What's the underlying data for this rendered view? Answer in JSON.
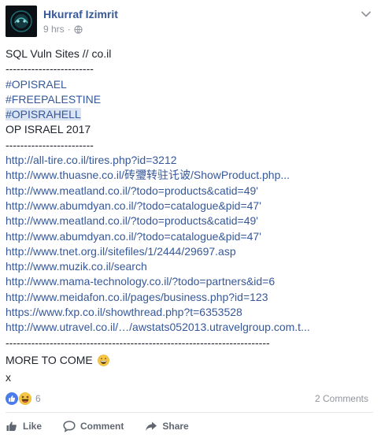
{
  "post": {
    "author": "Hkurraf Izimrit",
    "timestamp": "9 hrs",
    "separator": "·",
    "privacy_icon": "globe-icon",
    "options_icon": "chevron-down-icon"
  },
  "content": {
    "lines": [
      {
        "text": "SQL Vuln Sites // co.il",
        "kind": "text"
      },
      {
        "text": "------------------------",
        "kind": "text"
      },
      {
        "text": "#OPISRAEL",
        "kind": "hashtag"
      },
      {
        "text": "#FREEPALESTINE",
        "kind": "hashtag"
      },
      {
        "text": "#OPISRAHELL",
        "kind": "hashtag-highlight"
      },
      {
        "text": "OP ISRAEL 2017",
        "kind": "text"
      },
      {
        "text": "------------------------",
        "kind": "text"
      },
      {
        "text": "http://all-tire.co.il/tires.php?id=3212",
        "kind": "link"
      },
      {
        "text": "http://www.thuasne.co.il/砖瓕转驻讬诐/ShowProduct.php...",
        "kind": "link"
      },
      {
        "text": "http://www.meatland.co.il/?todo=products&catid=49'",
        "kind": "link"
      },
      {
        "text": "http://www.abumdyan.co.il/?todo=catalogue&pid=47'",
        "kind": "link"
      },
      {
        "text": "http://www.meatland.co.il/?todo=products&catid=49'",
        "kind": "link"
      },
      {
        "text": "http://www.abumdyan.co.il/?todo=catalogue&pid=47'",
        "kind": "link"
      },
      {
        "text": "http://www.tnet.org.il/sitefiles/1/2444/29697.asp",
        "kind": "link"
      },
      {
        "text": "http://www.muzik.co.il/search",
        "kind": "link"
      },
      {
        "text": "http://www.mama-technology.co.il/?todo=partners&id=6",
        "kind": "link"
      },
      {
        "text": "http://www.meidafon.co.il/pages/business.php?id=123",
        "kind": "link"
      },
      {
        "text": "https://www.fxp.co.il/showthread.php?t=6353528",
        "kind": "link"
      },
      {
        "text": "http://www.utravel.co.il/…/awstats052013.utravelgroup.com.t...",
        "kind": "link"
      },
      {
        "text": "------------------------------------------------------------------------",
        "kind": "text"
      },
      {
        "text": "MORE TO COME",
        "kind": "text-emoji"
      },
      {
        "text": "x",
        "kind": "text"
      }
    ]
  },
  "reactions": {
    "count": "6",
    "icons": [
      "like-reaction-icon",
      "haha-reaction-icon"
    ]
  },
  "comments_count": "2 Comments",
  "actions": {
    "like_label": "Like",
    "comment_label": "Comment",
    "share_label": "Share"
  },
  "colors": {
    "link": "#365899",
    "meta": "#90949c",
    "highlight": "#dbe4f2"
  }
}
